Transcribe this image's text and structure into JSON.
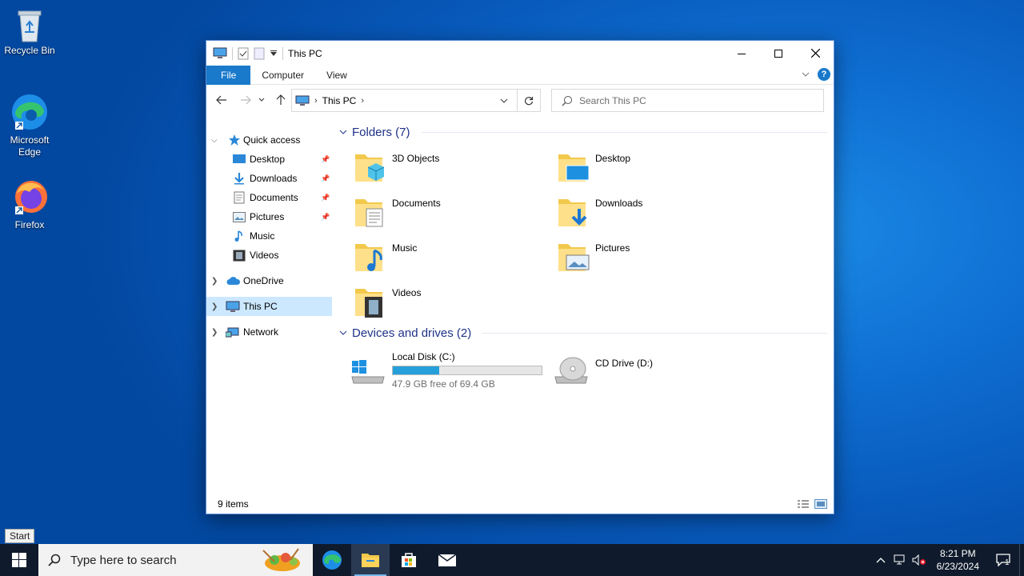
{
  "desktop": {
    "icons": [
      {
        "label": "Recycle Bin",
        "icon": "recycle-bin-icon"
      },
      {
        "label": "Microsoft Edge",
        "icon": "edge-icon"
      },
      {
        "label": "Firefox",
        "icon": "firefox-icon"
      }
    ]
  },
  "window": {
    "title": "This PC",
    "ribbon_tabs": [
      "File",
      "Computer",
      "View"
    ],
    "address": {
      "crumb": "This PC"
    },
    "search": {
      "placeholder": "Search This PC"
    },
    "nav": {
      "quick_access": "Quick access",
      "quick_items": [
        "Desktop",
        "Downloads",
        "Documents",
        "Pictures",
        "Music",
        "Videos"
      ],
      "onedrive": "OneDrive",
      "this_pc": "This PC",
      "network": "Network"
    },
    "folders_header": "Folders (7)",
    "folders": [
      "3D Objects",
      "Desktop",
      "Documents",
      "Downloads",
      "Music",
      "Pictures",
      "Videos"
    ],
    "drives_header": "Devices and drives (2)",
    "drives": [
      {
        "name": "Local Disk (C:)",
        "free_text": "47.9 GB free of 69.4 GB",
        "used_fraction": 0.31
      },
      {
        "name": "CD Drive (D:)"
      }
    ],
    "status": "9 items"
  },
  "taskbar": {
    "search_placeholder": "Type here to search",
    "tooltip": "Start",
    "time": "8:21 PM",
    "date": "6/23/2024",
    "notification_count": "1"
  },
  "colors": {
    "accent": "#1979ca",
    "selection": "#cce8ff",
    "taskbar": "#0f1b2c",
    "drive_fill": "#26a0da"
  }
}
